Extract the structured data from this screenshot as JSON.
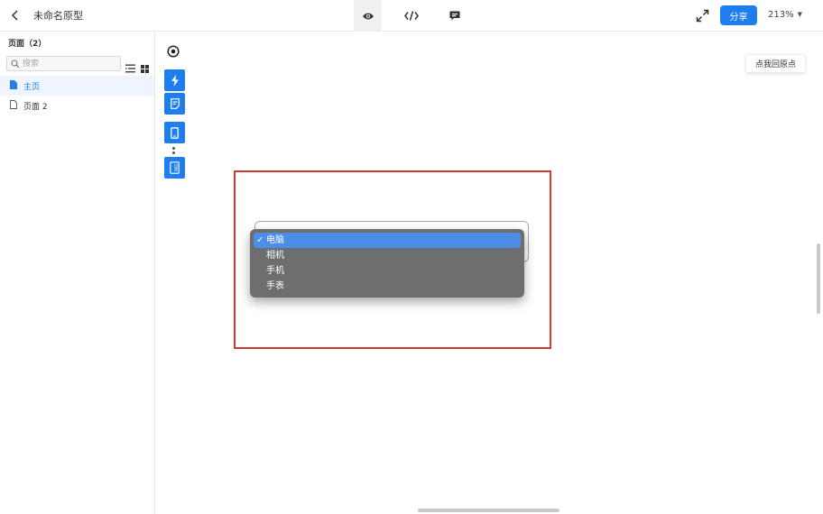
{
  "header": {
    "title": "未命名原型",
    "share_label": "分享",
    "zoom": "213%",
    "mode_tabs": [
      "preview-icon",
      "code-icon",
      "comment-icon"
    ],
    "accent": "#1e7ef0"
  },
  "sidebar": {
    "title": "页面（2）",
    "search": {
      "placeholder": "搜索",
      "value": ""
    },
    "pages": [
      {
        "label": "主页",
        "active": true
      },
      {
        "label": "页面 2",
        "active": false
      }
    ]
  },
  "canvas": {
    "origin_button": "点我回原点",
    "frame_color": "#d63a2f",
    "select": {
      "options": [
        {
          "label": "电脑",
          "selected": true
        },
        {
          "label": "相机",
          "selected": false
        },
        {
          "label": "手机",
          "selected": false
        },
        {
          "label": "手表",
          "selected": false
        }
      ],
      "check_glyph": "✓"
    },
    "toolstrip": [
      "target-icon",
      "lightning-icon",
      "note-icon",
      "device-icon",
      "toggle-on-icon"
    ]
  }
}
